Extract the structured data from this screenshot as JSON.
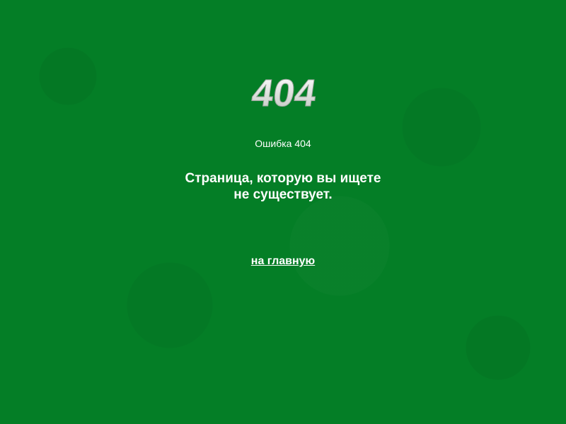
{
  "error": {
    "logo_text": "404",
    "code_label": "Ошибка 404",
    "message_line1": "Страница, которую вы ищете",
    "message_line2": "не существует.",
    "home_link_label": "на главную"
  },
  "colors": {
    "background": "#047e26",
    "text": "#ffffff"
  }
}
